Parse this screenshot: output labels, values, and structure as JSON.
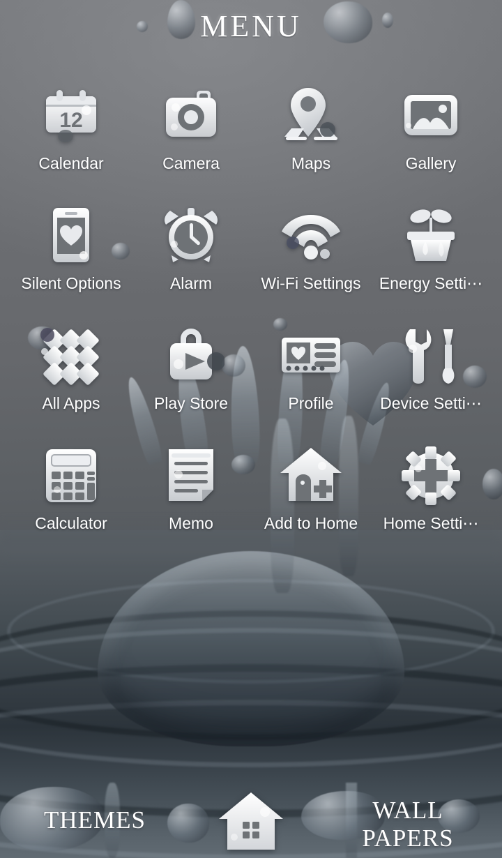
{
  "header": {
    "title": "MENU"
  },
  "apps": [
    {
      "label": "Calendar",
      "icon": "calendar-icon",
      "day": "12"
    },
    {
      "label": "Camera",
      "icon": "camera-icon"
    },
    {
      "label": "Maps",
      "icon": "map-pin-icon"
    },
    {
      "label": "Gallery",
      "icon": "gallery-icon"
    },
    {
      "label": "Silent Options",
      "icon": "phone-heart-icon"
    },
    {
      "label": "Alarm",
      "icon": "alarm-clock-icon"
    },
    {
      "label": "Wi-Fi Settings",
      "icon": "wifi-icon"
    },
    {
      "label": "Energy Setti⋯",
      "icon": "plant-pot-icon"
    },
    {
      "label": "All Apps",
      "icon": "app-grid-icon"
    },
    {
      "label": "Play Store",
      "icon": "play-store-bag-icon"
    },
    {
      "label": "Profile",
      "icon": "profile-card-icon"
    },
    {
      "label": "Device Setti⋯",
      "icon": "wrench-screwdriver-icon"
    },
    {
      "label": "Calculator",
      "icon": "calculator-icon"
    },
    {
      "label": "Memo",
      "icon": "memo-page-icon"
    },
    {
      "label": "Add to Home",
      "icon": "house-plus-icon"
    },
    {
      "label": "Home Setti⋯",
      "icon": "gear-plus-icon"
    }
  ],
  "dock": {
    "themes_label": "THEMES",
    "home_icon": "home-icon",
    "wallpapers_line1": "WALL",
    "wallpapers_line2": "PAPERS"
  },
  "colors": {
    "label_text": "#ffffff",
    "title_text": "#ffffff",
    "background_top": "#6e7073",
    "background_bottom": "#2f373e",
    "icon_light": "#f2f3f5",
    "icon_shadow": "#6a6d72"
  }
}
